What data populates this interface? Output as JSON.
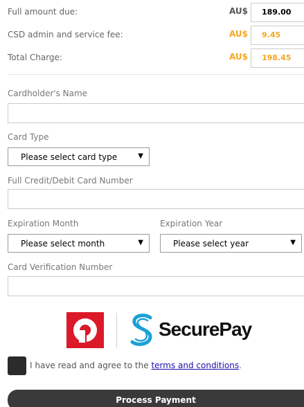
{
  "fees": [
    {
      "label": "Full amount due:",
      "currency": "AU$",
      "value": "189.00",
      "currency_color": "#555555",
      "value_color": "#000000"
    },
    {
      "label": "CSD admin and service fee:",
      "currency": "AU$",
      "value": "9.45",
      "currency_color": "#f5a623",
      "value_color": "#f5a623"
    },
    {
      "label": "Total Charge:",
      "currency": "AU$",
      "value": "198.45",
      "currency_color": "#f5a623",
      "value_color": "#f5a623"
    }
  ],
  "form": {
    "cardholder_label": "Cardholder's Name",
    "cardholder_value": "",
    "card_type_label": "Card Type",
    "card_type_selected": "Please select card type",
    "card_number_label": "Full Credit/Debit Card Number",
    "card_number_value": "",
    "exp_month_label": "Expiration Month",
    "exp_month_selected": "Please select month",
    "exp_year_label": "Expiration Year",
    "exp_year_selected": "Please select year",
    "cvn_label": "Card Verification Number",
    "cvn_value": ""
  },
  "branding": {
    "securepay_text": "SecurePay",
    "auspost_color": "#dc1928",
    "securepay_color": "#1aa0d8"
  },
  "agreement": {
    "text_before": "I have read and agree to the ",
    "link_text": "terms and conditions",
    "text_after": "."
  },
  "actions": {
    "process_label": "Process Payment"
  },
  "icons": {
    "select_arrow": "▼"
  }
}
